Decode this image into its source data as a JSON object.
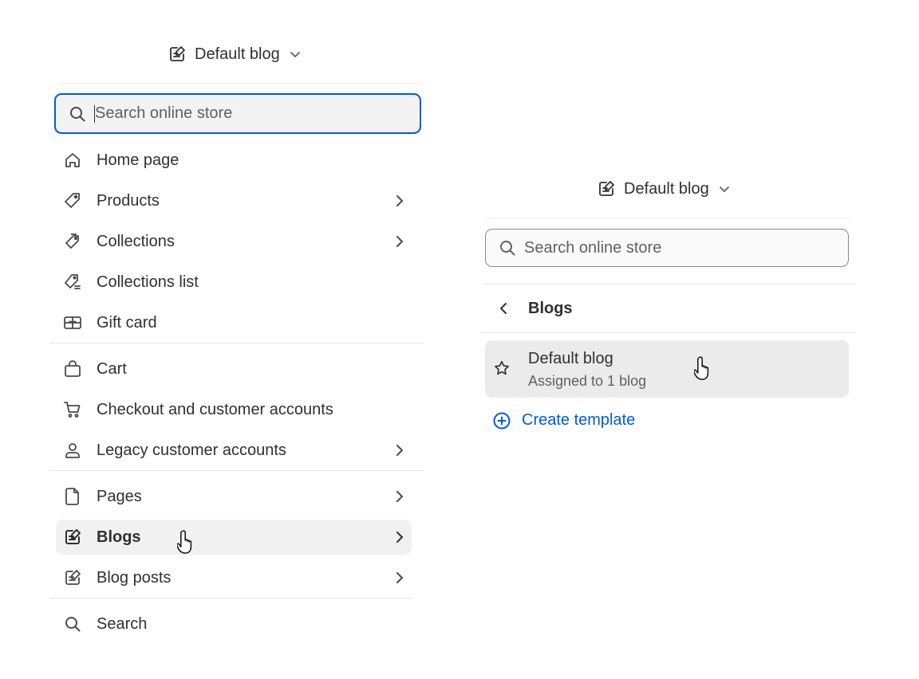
{
  "left": {
    "selector_label": "Default blog",
    "search_placeholder": "Search online store",
    "items": [
      {
        "label": "Home page"
      },
      {
        "label": "Products"
      },
      {
        "label": "Collections"
      },
      {
        "label": "Collections list"
      },
      {
        "label": "Gift card"
      },
      {
        "label": "Cart"
      },
      {
        "label": "Checkout and customer accounts"
      },
      {
        "label": "Legacy customer accounts"
      },
      {
        "label": "Pages"
      },
      {
        "label": "Blogs"
      },
      {
        "label": "Blog posts"
      },
      {
        "label": "Search"
      }
    ]
  },
  "right": {
    "selector_label": "Default blog",
    "search_placeholder": "Search online store",
    "back_title": "Blogs",
    "template": {
      "title": "Default blog",
      "subtitle": "Assigned to 1 blog"
    },
    "create_label": "Create template"
  },
  "colors": {
    "accent": "#005bd3",
    "hover_bg": "#ebebeb",
    "text": "#303030"
  }
}
